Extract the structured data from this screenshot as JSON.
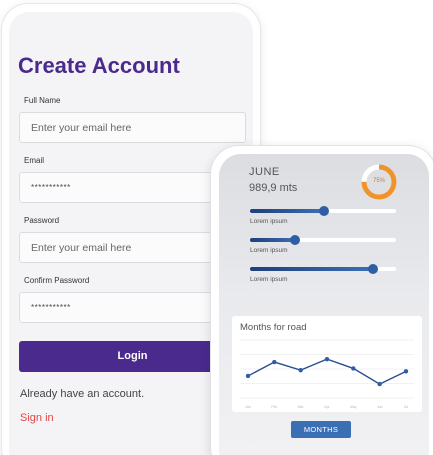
{
  "signup": {
    "title": "Create Account",
    "full_name_label": "Full Name",
    "full_name_placeholder": "Enter your email here",
    "email_label": "Email",
    "email_value": "***********",
    "password_label": "Password",
    "password_placeholder": "Enter your email here",
    "confirm_label": "Confirm Password",
    "confirm_value": "***********",
    "login_button": "Login",
    "already_text": "Already have an account.",
    "signin_link": "Sign in",
    "colors": {
      "brand": "#4a2a8c",
      "link": "#e04747"
    }
  },
  "dashboard": {
    "month": "JUNE",
    "distance": "989,9 mts",
    "progress_label": "75%",
    "progress": 0.75,
    "sliders": [
      {
        "label": "Lorem ipsum",
        "value": 0.51
      },
      {
        "label": "Lorem ipsum",
        "value": 0.31
      },
      {
        "label": "Lorem ipsum",
        "value": 0.84
      }
    ],
    "months_button": "MONTHS",
    "colors": {
      "accent": "#3a6fb4",
      "dark": "#1f3f7a",
      "donut": "#f0932b"
    }
  },
  "chart_data": {
    "type": "line",
    "title": "Months for road",
    "categories": [
      "Jan",
      "Feb",
      "Mar",
      "Apr",
      "May",
      "Jun",
      "Jul"
    ],
    "series": [
      {
        "values": [
          38,
          62,
          48,
          67,
          51,
          24,
          46
        ]
      }
    ],
    "ylim": [
      0,
      100
    ],
    "grid": true
  }
}
